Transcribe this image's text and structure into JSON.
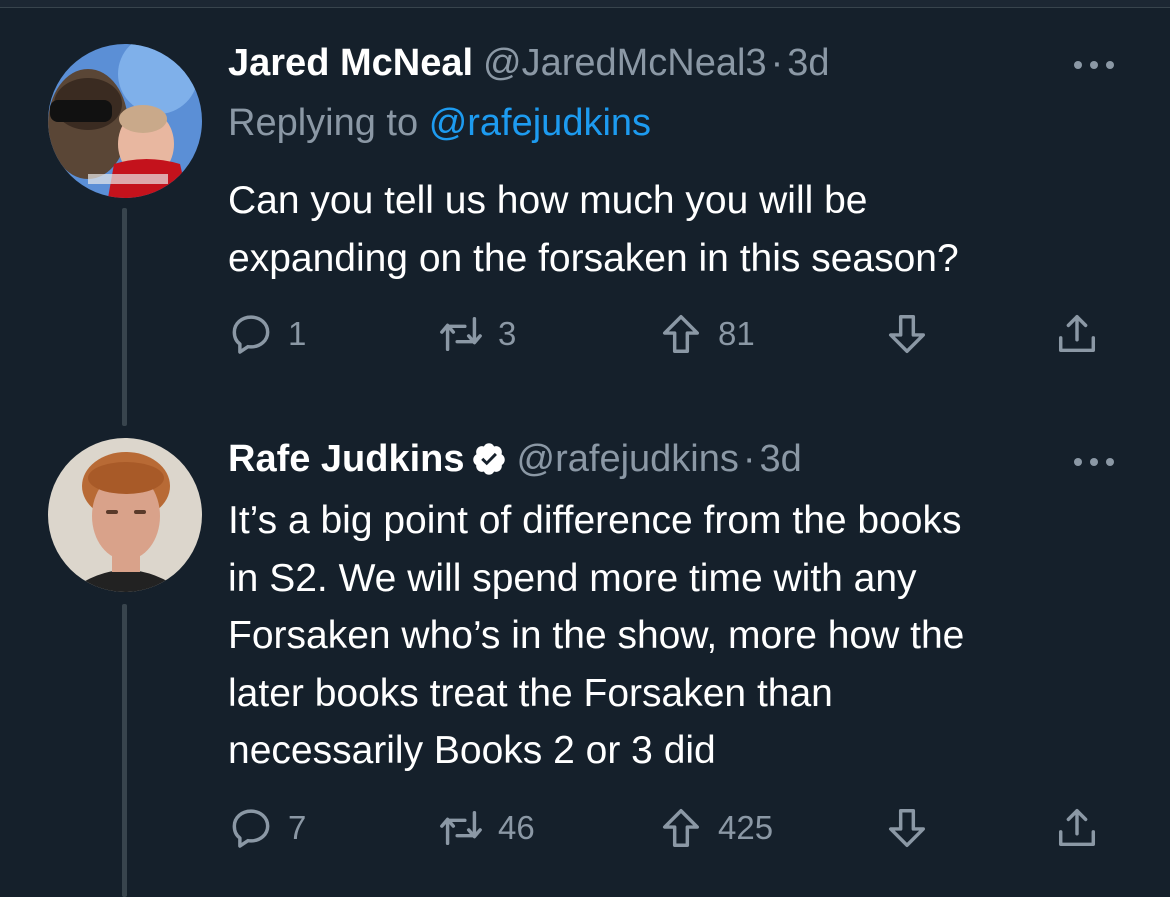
{
  "tweets": [
    {
      "display_name": "Jared McNeal",
      "handle": "@JaredMcNeal3",
      "separator": "·",
      "time": "3d",
      "replying_prefix": "Replying to",
      "replying_handle": "@rafejudkins",
      "text": "Can you tell us how much you will be\nexpanding on the forsaken in this season?",
      "counts": {
        "replies": "1",
        "retweets": "3",
        "upvotes": "81"
      }
    },
    {
      "display_name": "Rafe Judkins",
      "verified": true,
      "handle": "@rafejudkins",
      "separator": "·",
      "time": "3d",
      "text": "It’s a big point of difference from the books\nin S2.  We will spend more time with any\nForsaken who’s in the show, more how the\nlater books treat the Forsaken than\nnecessarily Books 2 or 3 did",
      "counts": {
        "replies": "7",
        "retweets": "46",
        "upvotes": "425"
      }
    }
  ],
  "colors": {
    "background": "#15202b",
    "text_primary": "#ffffff",
    "text_secondary": "#8b98a5",
    "link": "#1d9bf0",
    "thread_line": "#38444d"
  },
  "icons": {
    "reply": "speech-bubble-icon",
    "retweet": "retweet-arrows-icon",
    "upvote": "arrow-up-icon",
    "downvote": "arrow-down-icon",
    "share": "share-upload-icon",
    "more": "more-dots-icon",
    "verified": "verified-badge-icon"
  }
}
